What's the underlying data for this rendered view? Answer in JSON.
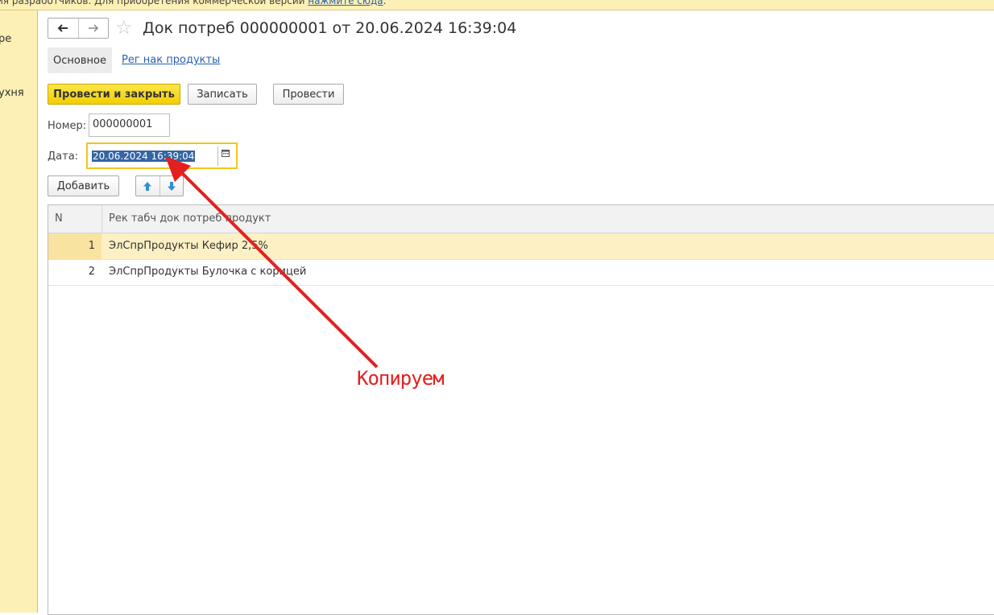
{
  "banner": {
    "text": "ия разработчиков. Для приобретения коммерческой версии ",
    "link": "нажмите сюда",
    "tail": "."
  },
  "sidebar": {
    "items": [
      {
        "label": "ре"
      },
      {
        "label": "ухня"
      }
    ]
  },
  "header": {
    "back_icon": "arrow-left-icon",
    "forward_icon": "arrow-right-icon",
    "favorite_icon": "star-icon",
    "title": "Док потреб 000000001 от 20.06.2024 16:39:04"
  },
  "tabs": [
    {
      "label": "Основное"
    },
    {
      "label": "Рег нак продукты"
    }
  ],
  "toolbar": {
    "post_close": "Провести и закрыть",
    "save": "Записать",
    "post": "Провести"
  },
  "form": {
    "number_label": "Номер:",
    "number_value": "000000001",
    "date_label": "Дата:",
    "date_value": "20.06.2024 16:39:04",
    "calendar_icon": "calendar-icon"
  },
  "table_toolbar": {
    "add": "Добавить",
    "up_icon": "arrow-up-icon",
    "down_icon": "arrow-down-icon"
  },
  "table": {
    "columns": [
      "N",
      "Рек табч док потреб продукт"
    ],
    "rows": [
      {
        "n": "1",
        "product": "ЭлСпрПродукты Кефир 2,5%"
      },
      {
        "n": "2",
        "product": "ЭлСпрПродукты Булочка с корицей"
      }
    ]
  },
  "annotation": {
    "text": "Копируем",
    "color": "#e32020"
  }
}
